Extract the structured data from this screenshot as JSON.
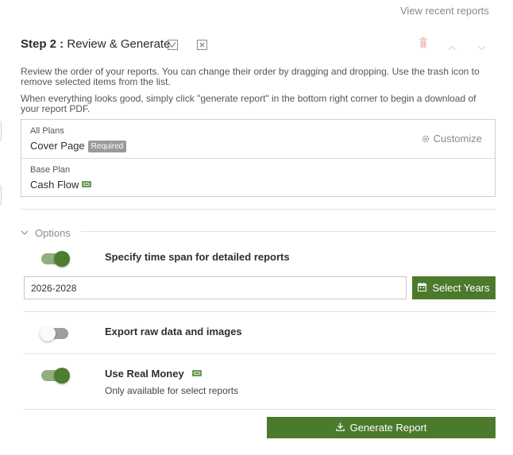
{
  "top": {
    "view_recent": "View recent reports"
  },
  "step": {
    "number": "Step 2 :",
    "title": "Review & Generate"
  },
  "description": {
    "line1": "Review the order of your reports. You can change their order by dragging and dropping. Use the trash icon to remove selected items from the list.",
    "line2": "When everything looks good, simply click \"generate report\" in the bottom right corner to begin a download of your report PDF."
  },
  "report_items": [
    {
      "category": "All Plans",
      "name": "Cover Page",
      "badge": "Required",
      "action": "Customize",
      "action_icon": "gear-icon"
    },
    {
      "category": "Base Plan",
      "name": "Cash Flow",
      "icon": "money-icon"
    }
  ],
  "options": {
    "heading": "Options",
    "time_span": {
      "label": "Specify time span for detailed reports",
      "enabled": true,
      "value": "2026-2028",
      "button": "Select Years"
    },
    "raw_data": {
      "label": "Export raw data and images",
      "enabled": false
    },
    "real_money": {
      "label": "Use Real Money",
      "sub": "Only available for select reports",
      "enabled": true
    }
  },
  "footer": {
    "generate": "Generate Report"
  },
  "colors": {
    "accent": "#4b7a2c",
    "toggle_track_on": "#8fb07e",
    "badge": "#9a9a9a"
  }
}
